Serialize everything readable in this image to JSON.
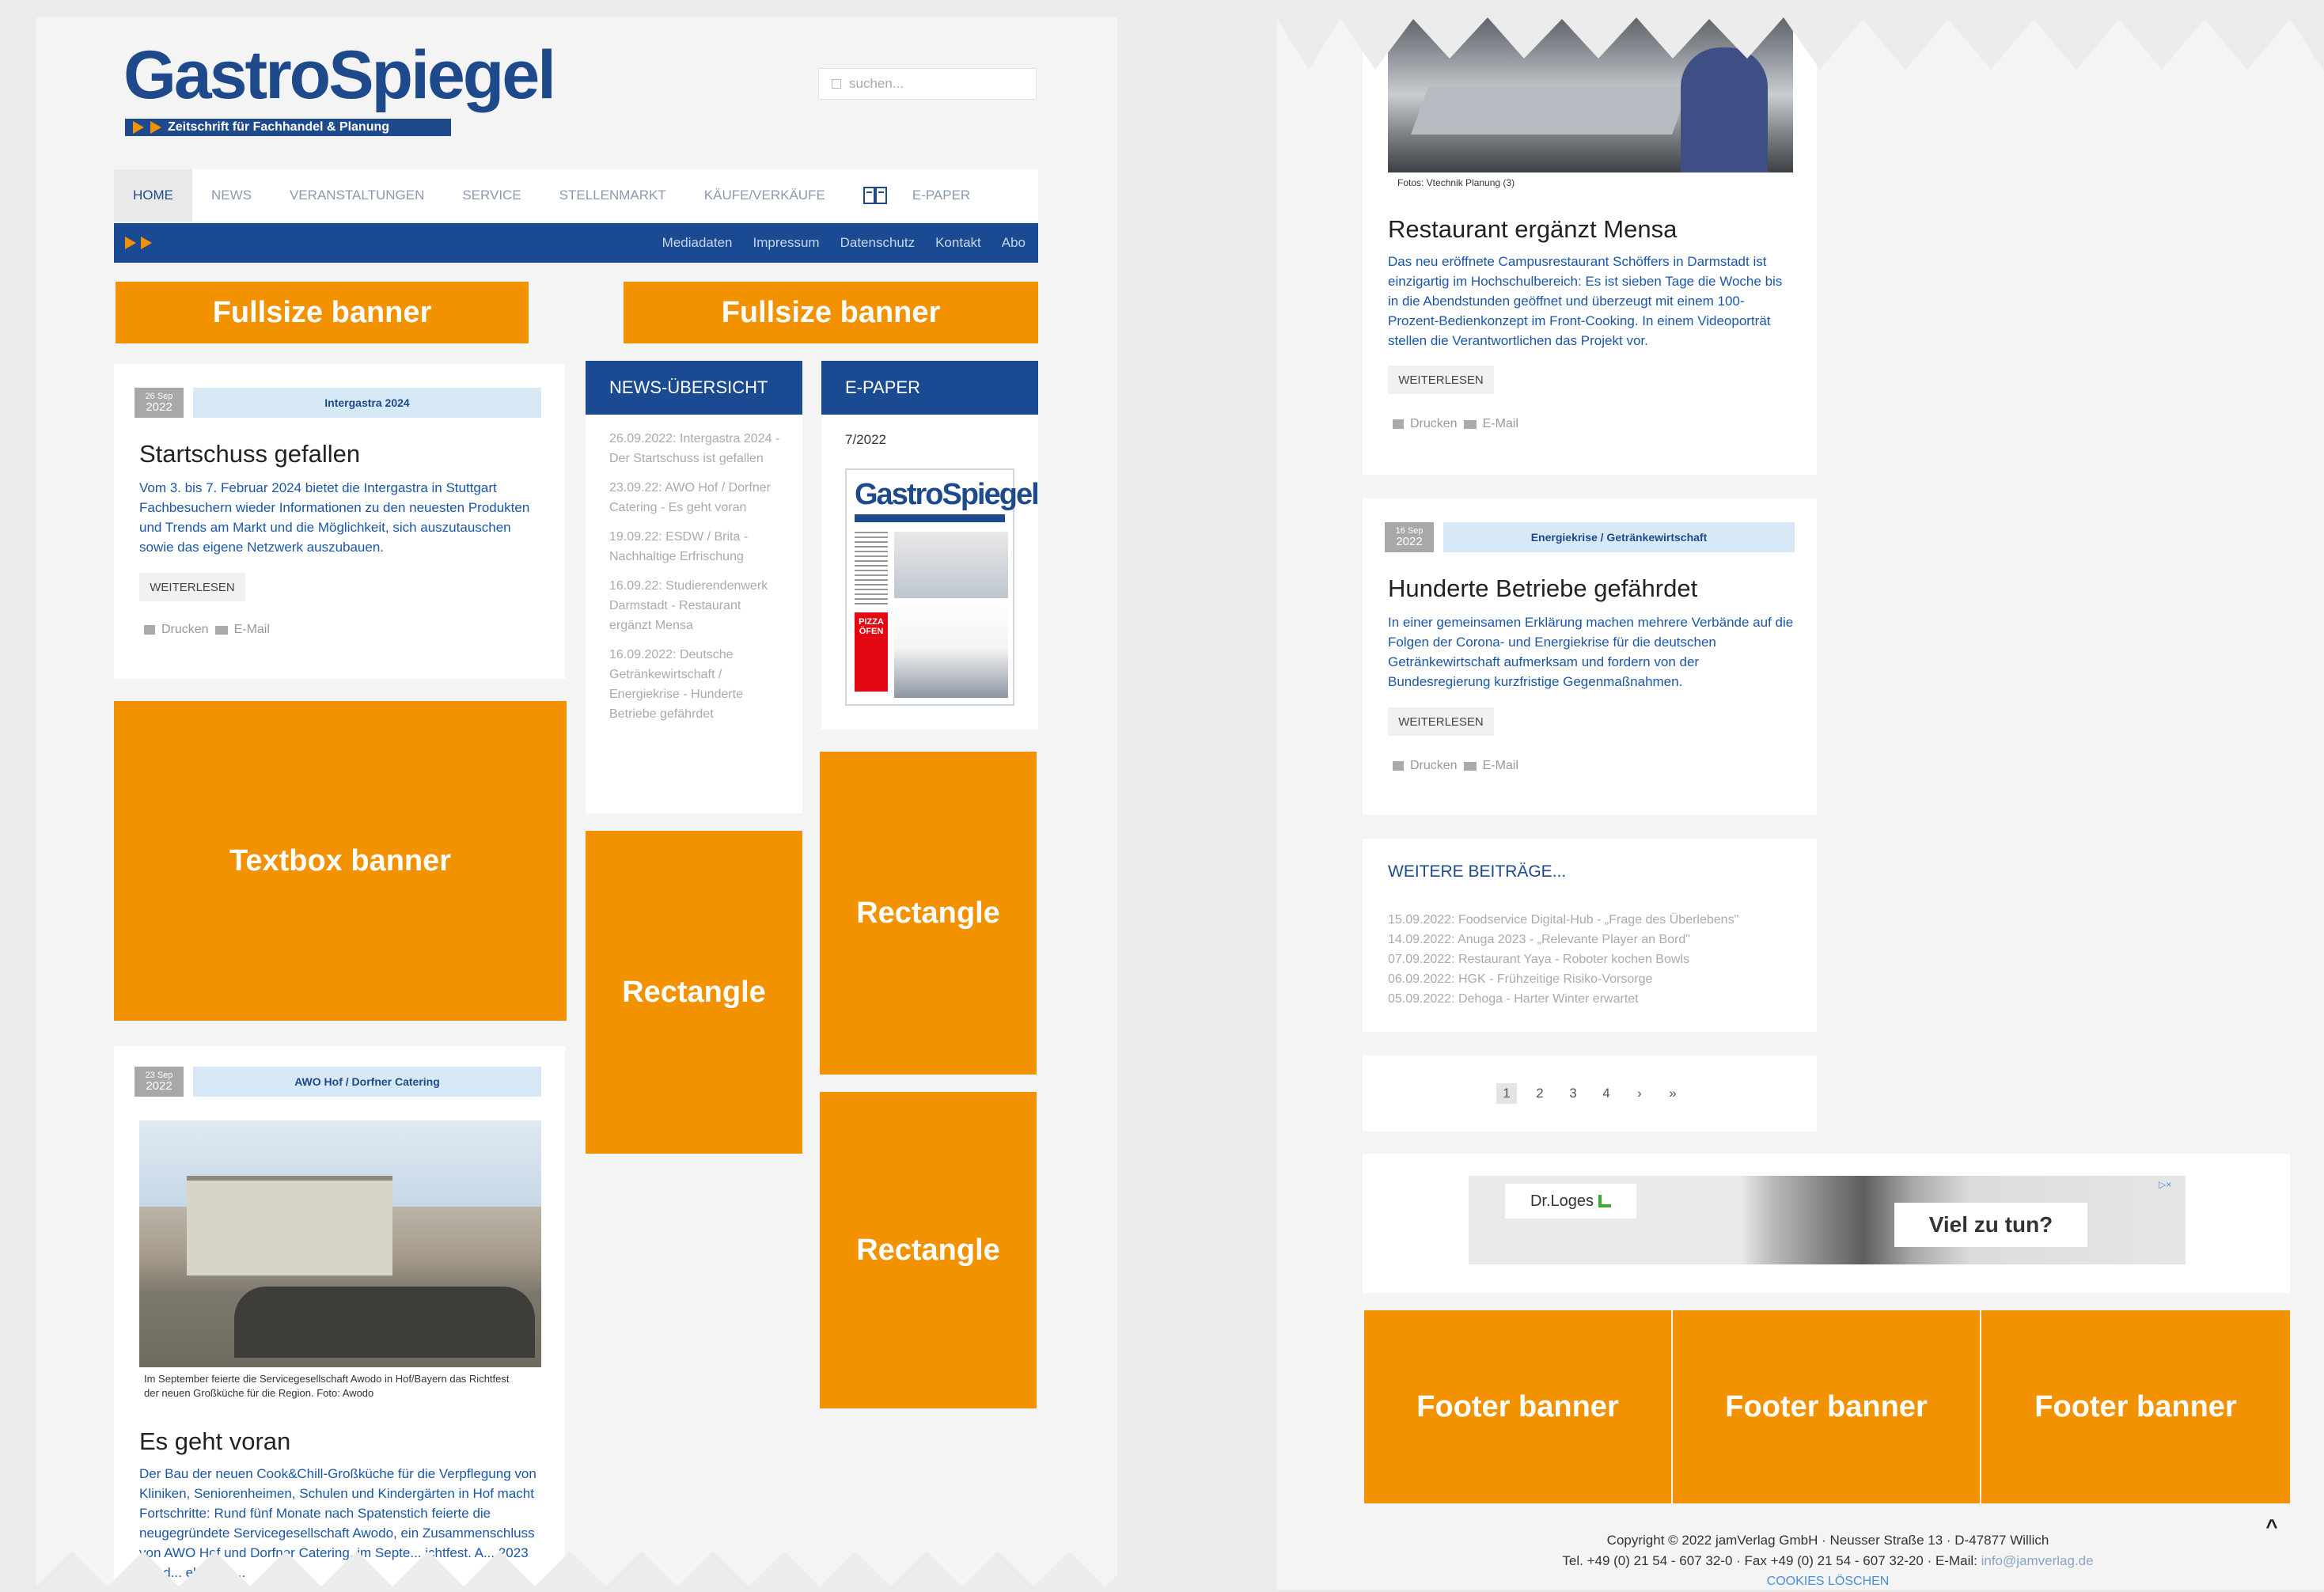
{
  "header": {
    "logo_main": "GastroSpiegel",
    "logo_sub": "Zeitschrift für Fachhandel & Planung",
    "search_placeholder": "suchen..."
  },
  "nav": {
    "items": [
      "HOME",
      "NEWS",
      "VERANSTALTUNGEN",
      "SERVICE",
      "STELLENMARKT",
      "KÄUFE/VERKÄUFE",
      "E-PAPER"
    ]
  },
  "subnav": {
    "items": [
      "Mediadaten",
      "Impressum",
      "Datenschutz",
      "Kontakt",
      "Abo"
    ]
  },
  "banners": {
    "fullsize_1": "Fullsize banner",
    "fullsize_2": "Fullsize banner",
    "textbox": "Textbox banner",
    "rect_1": "Rectangle",
    "rect_2": "Rectangle",
    "rect_3": "Rectangle",
    "footer_1": "Footer banner",
    "footer_2": "Footer banner",
    "footer_3": "Footer banner"
  },
  "articles": [
    {
      "date_day": "26 Sep",
      "date_year": "2022",
      "category": "Intergastra 2024",
      "title": "Startschuss gefallen",
      "teaser": "Vom 3. bis 7. Februar 2024 bietet die Intergastra in Stuttgart Fachbesuchern wieder Informationen zu den neuesten Produkten und Trends am Markt und die Möglichkeit, sich auszutauschen sowie das eigene Netzwerk auszubauen.",
      "read_more": "WEITERLESEN",
      "print": "Drucken",
      "email": "E-Mail"
    },
    {
      "date_day": "23 Sep",
      "date_year": "2022",
      "category": "AWO Hof / Dorfner Catering",
      "caption": "Im September feierte die Servicegesellschaft Awodo in Hof/Bayern das Richtfest der neuen Großküche für die Region. Foto: Awodo",
      "title": "Es geht voran",
      "teaser": "Der Bau der neuen Cook&Chill-Großküche für die Verpflegung von Kliniken, Seniorenheimen, Schulen und Kindergärten in Hof macht Fortschritte: Rund fünf Monate nach Spatenstich feierte die neugegründete Servicegesellschaft Awodo, ein Zusammenschluss von AWO Hof und Dorfner Catering, im Septe... ichtfest. A... 2023 soll d... ebetrieb..."
    },
    {
      "caption": "Fotos: Vtechnik Planung (3)",
      "title": "Restaurant ergänzt Mensa",
      "teaser": "Das neu eröffnete Campusrestaurant Schöffers in Darmstadt ist einzigartig im Hochschulbereich: Es ist sieben Tage die Woche bis in die Abendstunden geöffnet und überzeugt mit einem 100-Prozent-Bedienkonzept im Front-Cooking. In einem Videoporträt stellen die Verantwortlichen das Projekt vor.",
      "read_more": "WEITERLESEN",
      "print": "Drucken",
      "email": "E-Mail"
    },
    {
      "date_day": "16 Sep",
      "date_year": "2022",
      "category": "Energiekrise / Getränkewirtschaft",
      "title": "Hunderte Betriebe gefährdet",
      "teaser": "In einer gemeinsamen Erklärung machen mehrere Verbände auf die Folgen der Corona- und Energiekrise für die deutschen Getränkewirtschaft aufmerksam und fordern von der Bundesregierung kurzfristige Gegenmaßnahmen.",
      "read_more": "WEITERLESEN",
      "print": "Drucken",
      "email": "E-Mail"
    }
  ],
  "news_overview": {
    "title": "NEWS-ÜBERSICHT",
    "items": [
      "26.09.2022: Intergastra 2024 - Der Startschuss ist gefallen",
      "23.09.22: AWO Hof / Dorfner Catering - Es geht voran",
      "19.09.22: ESDW / Brita - Nachhaltige Erfrischung",
      "16.09.22: Studierendenwerk Darmstadt - Restaurant ergänzt Mensa",
      "16.09.2022: Deutsche Getränkewirtschaft / Energiekrise - Hunderte Betriebe gefährdet"
    ]
  },
  "epaper": {
    "title": "E-PAPER",
    "issue": "7/2022",
    "cover_logo": "GastroSpiegel",
    "cover_promo": "PIZZA ÖFEN"
  },
  "more_posts": {
    "title": "WEITERE BEITRÄGE...",
    "items": [
      "15.09.2022: Foodservice Digital-Hub - „Frage des Überlebens\"",
      "14.09.2022: Anuga 2023 - „Relevante Player an Bord\"",
      "07.09.2022: Restaurant Yaya - Roboter kochen Bowls",
      "06.09.2022: HGK - Frühzeitige Risiko-Vorsorge",
      "05.09.2022: Dehoga - Harter Winter erwartet"
    ]
  },
  "pagination": [
    "1",
    "2",
    "3",
    "4",
    "›",
    "»"
  ],
  "ad": {
    "brand": "Dr.Loges",
    "headline": "Viel zu tun?"
  },
  "footer": {
    "copyright": "Copyright © 2022 jamVerlag GmbH · Neusser Straße 13 · D-47877 Willich",
    "contact_prefix": "Tel. +49 (0) 21 54 - 607 32-0 · Fax +49 (0) 21 54 - 607 32-20 · E-Mail:",
    "email": "info@jamverlag.de",
    "cookies": "COOKIES LÖSCHEN",
    "top": "^"
  },
  "colors": {
    "brand_blue": "#1a4a91",
    "banner_orange": "#f39200",
    "teaser_blue": "#1a56a8"
  }
}
